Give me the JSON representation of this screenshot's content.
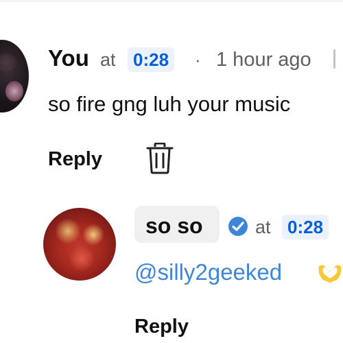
{
  "comment": {
    "author": "You",
    "at_label": "at",
    "timestamp": "0:28",
    "separator": "·",
    "time_ago": "1 hour ago",
    "text": "so fire gng luh your music",
    "reply_label": "Reply",
    "avatar_icon": "user-avatar",
    "delete_icon": "trash-icon",
    "menu_icon": "more-vert-icon"
  },
  "reply": {
    "author": "so so",
    "verified_icon": "verified-check-icon",
    "at_label": "at",
    "timestamp": "0:28",
    "mention": "@silly2geeked",
    "emoji_icon": "heart-hands-emoji",
    "reply_label": "Reply",
    "avatar_icon": "user-avatar"
  },
  "colors": {
    "link_blue": "#065fd4",
    "timestamp_bg": "#ebf2fd",
    "verified_blue": "#3e86d8",
    "secondary_text": "#606060",
    "chip_bg": "#f0f0f0"
  }
}
